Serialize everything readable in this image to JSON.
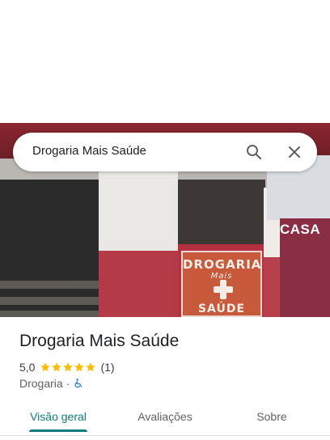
{
  "search": {
    "query": "Drogaria Mais Saúde",
    "search_icon": "search-icon",
    "close_icon": "close-icon"
  },
  "photo": {
    "sign_line1": "DROGARIA",
    "sign_line2": "Mais",
    "sign_line3": "SAÚDE",
    "neighbor_sign": "CASA"
  },
  "place": {
    "name": "Drogaria Mais Saúde",
    "rating": "5,0",
    "stars": 5,
    "review_count": "(1)",
    "category": "Drogaria",
    "separator": "·",
    "accessibility_icon": "wheelchair-icon"
  },
  "tabs": [
    {
      "label": "Visão geral",
      "active": true
    },
    {
      "label": "Avaliações",
      "active": false
    },
    {
      "label": "Sobre",
      "active": false
    }
  ],
  "colors": {
    "accent": "#0e7c7b",
    "star": "#fbbc04",
    "accessibility_icon": "#1a73e8"
  }
}
